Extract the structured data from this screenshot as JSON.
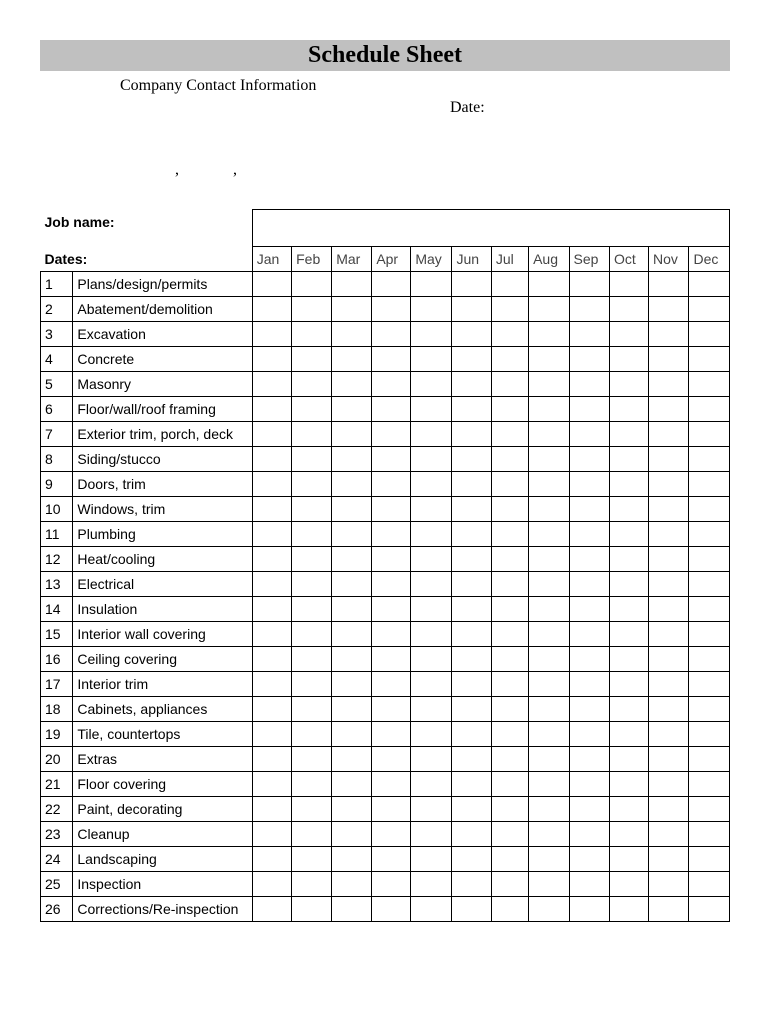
{
  "title": "Schedule Sheet",
  "company_contact_label": "Company Contact Information",
  "date_label": "Date:",
  "comma_placeholder_1": ",",
  "comma_placeholder_2": ",",
  "job_name_label": "Job name:",
  "dates_label": "Dates:",
  "months": [
    "Jan",
    "Feb",
    "Mar",
    "Apr",
    "May",
    "Jun",
    "Jul",
    "Aug",
    "Sep",
    "Oct",
    "Nov",
    "Dec"
  ],
  "tasks": [
    {
      "num": "1",
      "name": "Plans/design/permits"
    },
    {
      "num": "2",
      "name": "Abatement/demolition"
    },
    {
      "num": "3",
      "name": "Excavation"
    },
    {
      "num": "4",
      "name": "Concrete"
    },
    {
      "num": "5",
      "name": "Masonry"
    },
    {
      "num": "6",
      "name": "Floor/wall/roof framing"
    },
    {
      "num": "7",
      "name": "Exterior trim, porch, deck"
    },
    {
      "num": "8",
      "name": "Siding/stucco"
    },
    {
      "num": "9",
      "name": "Doors, trim"
    },
    {
      "num": "10",
      "name": "Windows, trim"
    },
    {
      "num": "11",
      "name": "Plumbing"
    },
    {
      "num": "12",
      "name": "Heat/cooling"
    },
    {
      "num": "13",
      "name": "Electrical"
    },
    {
      "num": "14",
      "name": "Insulation"
    },
    {
      "num": "15",
      "name": "Interior wall covering"
    },
    {
      "num": "16",
      "name": "Ceiling covering"
    },
    {
      "num": "17",
      "name": "Interior trim"
    },
    {
      "num": "18",
      "name": "Cabinets, appliances"
    },
    {
      "num": "19",
      "name": "Tile, countertops"
    },
    {
      "num": "20",
      "name": "Extras"
    },
    {
      "num": "21",
      "name": "Floor covering"
    },
    {
      "num": "22",
      "name": "Paint, decorating"
    },
    {
      "num": "23",
      "name": "Cleanup"
    },
    {
      "num": "24",
      "name": "Landscaping"
    },
    {
      "num": "25",
      "name": "Inspection"
    },
    {
      "num": "26",
      "name": "Corrections/Re-inspection"
    }
  ]
}
